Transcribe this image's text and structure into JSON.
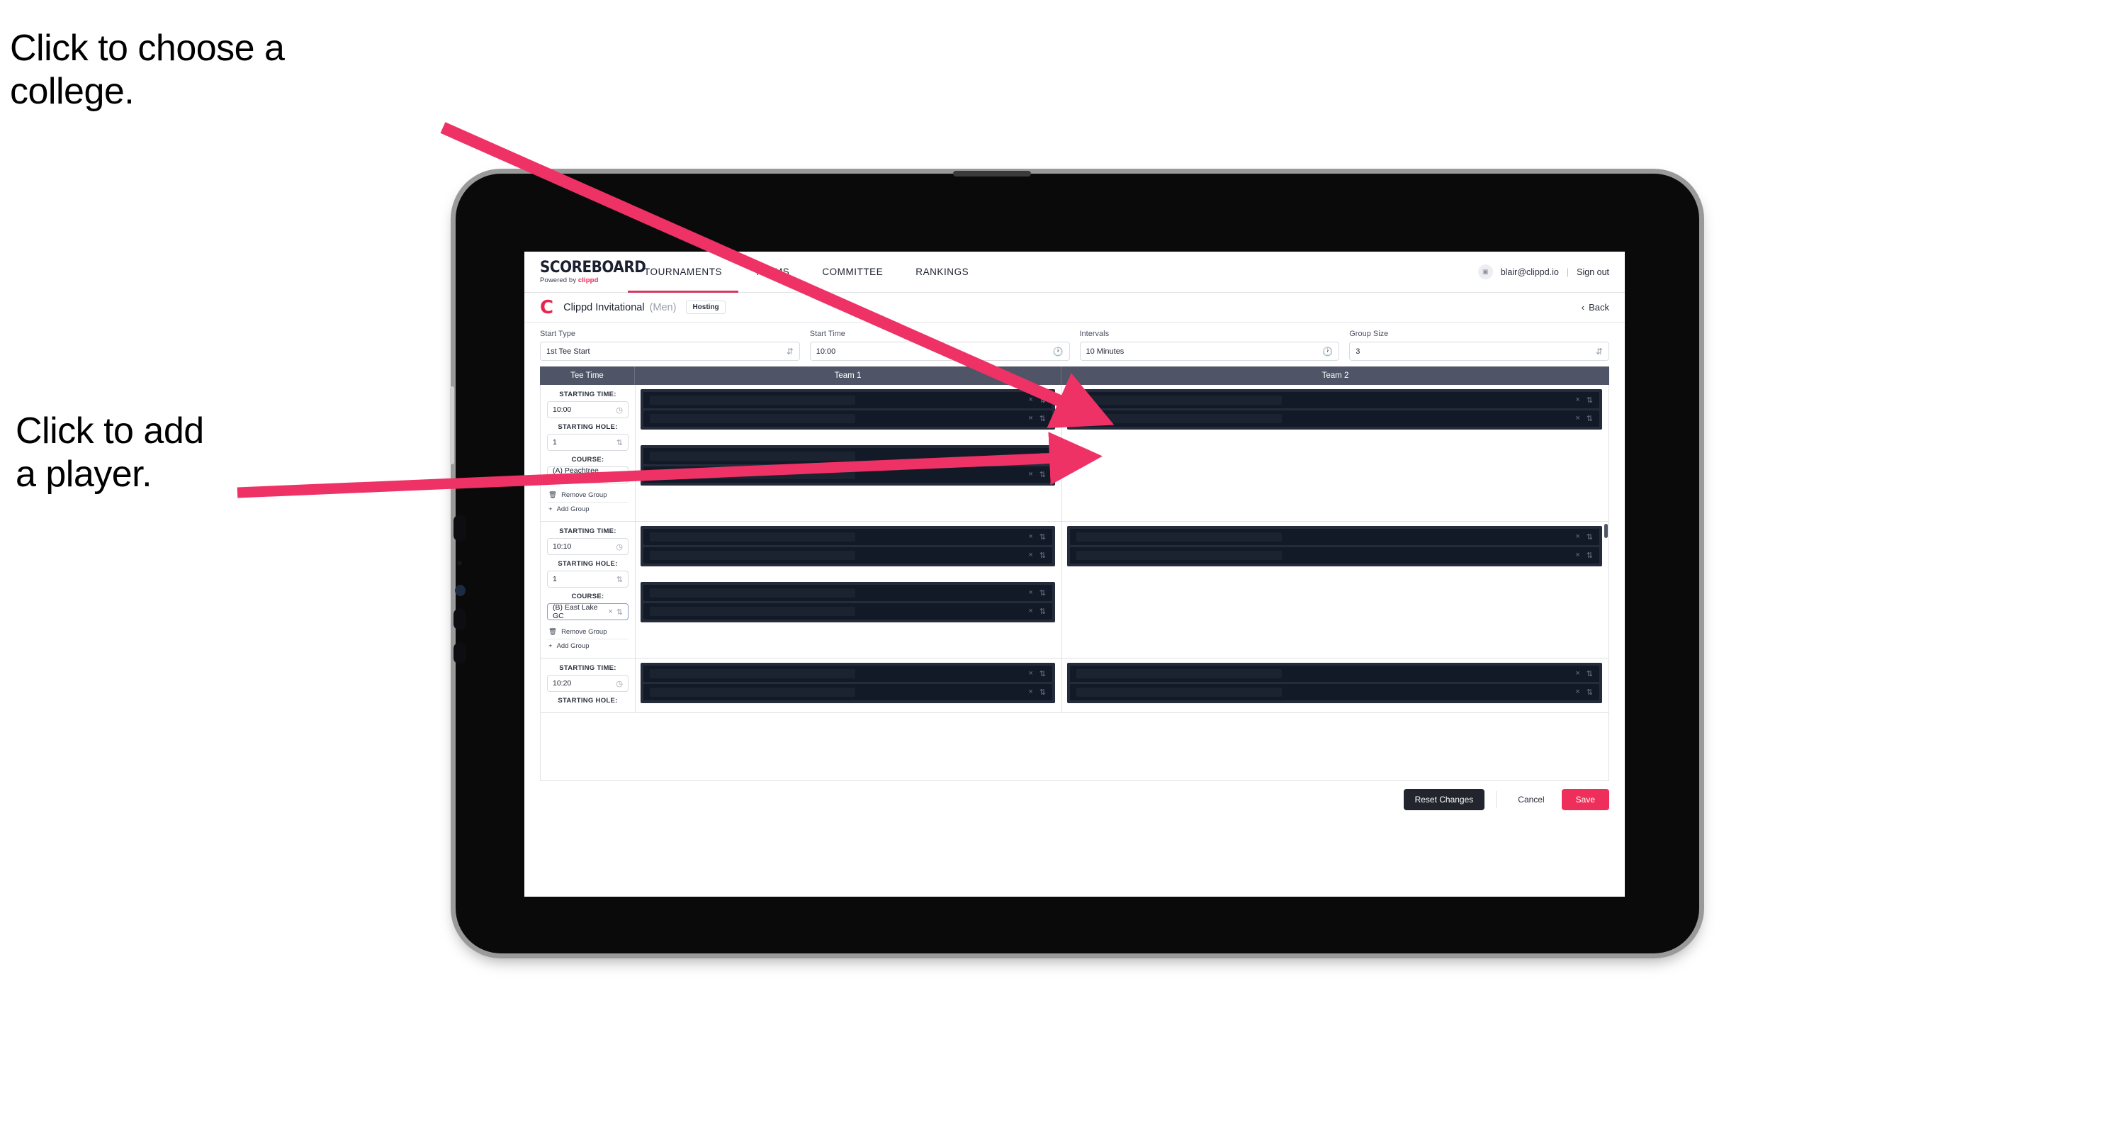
{
  "annotations": [
    {
      "id": "college",
      "text": "Click to choose a\ncollege."
    },
    {
      "id": "player",
      "text": "Click to add\na player."
    }
  ],
  "colors": {
    "brand_pink": "#e8254f",
    "save_pink": "#ef2f5b",
    "tab_underline": "#d4395e",
    "table_header": "#4f5567",
    "slot_dark": "#121a28",
    "slot_block": "#242c3c",
    "reset_dark": "#22252d",
    "arrow_pink": "#ee3266"
  },
  "topnav": {
    "logo_word": "SCOREBOARD",
    "logo_sub_prefix": "Powered by",
    "logo_sub_brand": "clippd",
    "tabs": [
      {
        "label": "TOURNAMENTS",
        "active": true
      },
      {
        "label": "TEAMS",
        "active": false
      },
      {
        "label": "COMMITTEE",
        "active": false
      },
      {
        "label": "RANKINGS",
        "active": false
      }
    ],
    "avatar_icon": "user-avatar-icon",
    "user_email": "blair@clippd.io",
    "separator": "|",
    "sign_out": "Sign out"
  },
  "tournament_bar": {
    "mark": "C",
    "title": "Clippd Invitational",
    "gender": "(Men)",
    "badge": "Hosting",
    "back_chevron": "‹",
    "back_label": "Back"
  },
  "form": {
    "fields": [
      {
        "label": "Start Type",
        "value": "1st Tee Start",
        "adorn": "stepper-icon"
      },
      {
        "label": "Start Time",
        "value": "10:00",
        "adorn": "clock-icon"
      },
      {
        "label": "Intervals",
        "value": "10 Minutes",
        "adorn": "clock-icon"
      },
      {
        "label": "Group Size",
        "value": "3",
        "adorn": "stepper-icon"
      }
    ]
  },
  "table": {
    "headers": [
      "Tee Time",
      "Team 1",
      "Team 2"
    ],
    "labels": {
      "starting_time": "STARTING TIME:",
      "starting_hole": "STARTING HOLE:",
      "course": "COURSE:",
      "remove_group": "Remove Group",
      "add_group": "Add Group"
    },
    "groups": [
      {
        "starting_time": "10:00",
        "starting_hole": "1",
        "course": "(A) Peachtree GC",
        "course_focused": false,
        "team1_blocks": [
          {
            "slots": [
              {
                "redact_w": 290
              },
              {
                "redact_w": 290
              }
            ]
          },
          {
            "slots": [
              {
                "redact_w": 290
              },
              {
                "redact_w": 290
              }
            ]
          }
        ],
        "team2_blocks": [
          {
            "slots": [
              {
                "redact_w": 290
              },
              {
                "redact_w": 290
              }
            ]
          }
        ]
      },
      {
        "starting_time": "10:10",
        "starting_hole": "1",
        "course": "(B) East Lake GC",
        "course_focused": true,
        "team1_blocks": [
          {
            "slots": [
              {
                "redact_w": 290
              },
              {
                "redact_w": 290
              }
            ]
          },
          {
            "slots": [
              {
                "redact_w": 290
              },
              {
                "redact_w": 290
              }
            ]
          }
        ],
        "team2_blocks": [
          {
            "slots": [
              {
                "redact_w": 290
              },
              {
                "redact_w": 290
              }
            ]
          }
        ]
      },
      {
        "starting_time": "10:20",
        "starting_hole": "",
        "course": "",
        "course_focused": false,
        "team1_blocks": [
          {
            "slots": [
              {
                "redact_w": 290
              },
              {
                "redact_w": 290
              }
            ]
          }
        ],
        "team2_blocks": [
          {
            "slots": [
              {
                "redact_w": 290
              },
              {
                "redact_w": 290
              }
            ]
          }
        ]
      }
    ]
  },
  "footer": {
    "reset": "Reset Changes",
    "cancel": "Cancel",
    "save": "Save"
  }
}
